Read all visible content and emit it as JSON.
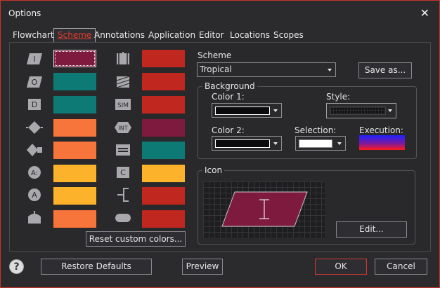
{
  "window": {
    "title": "Options"
  },
  "tabs": [
    "Flowchart",
    "Scheme",
    "Annotations",
    "Application",
    "Editor",
    "Locations",
    "Scopes"
  ],
  "active_tab": "Scheme",
  "symbols_left": [
    {
      "icon": "input-icon",
      "glyph": "I",
      "color": "#7d1a3d"
    },
    {
      "icon": "output-icon",
      "glyph": "O",
      "color": "#0d7a75"
    },
    {
      "icon": "declare-icon",
      "glyph": "D",
      "color": "#0d7a75"
    },
    {
      "icon": "decision-icon",
      "glyph": "",
      "color": "#f7743a"
    },
    {
      "icon": "loop-icon",
      "glyph": "",
      "color": "#f7743a"
    },
    {
      "icon": "assign-icon",
      "glyph": "A:",
      "color": "#fdb22b"
    },
    {
      "icon": "assignment-icon",
      "glyph": "A",
      "color": "#fdb22b"
    },
    {
      "icon": "end-block-icon",
      "glyph": "",
      "color": "#f7743a"
    }
  ],
  "symbols_right": [
    {
      "icon": "call-icon",
      "glyph": "",
      "color": "#c0271f"
    },
    {
      "icon": "parallel-icon",
      "glyph": "",
      "color": "#c0271f"
    },
    {
      "icon": "simulation-icon",
      "glyph": "SIM",
      "color": "#c0271f"
    },
    {
      "icon": "interrupt-icon",
      "glyph": "INT",
      "color": "#7d1a3d"
    },
    {
      "icon": "equals-icon",
      "glyph": "=",
      "color": "#0d7a75"
    },
    {
      "icon": "comment-icon",
      "glyph": "C",
      "color": "#fdb22b"
    },
    {
      "icon": "bracket-icon",
      "glyph": "",
      "color": "#c0271f"
    },
    {
      "icon": "terminal-icon",
      "glyph": "",
      "color": "#c0271f"
    }
  ],
  "reset_custom_colors": "Reset custom colors...",
  "scheme": {
    "label": "Scheme",
    "value": "Tropical",
    "save_as": "Save as..."
  },
  "background": {
    "title": "Background",
    "color1_label": "Color 1:",
    "color1": "#0c0c0e",
    "color2_label": "Color 2:",
    "color2": "#0c0c0e",
    "style_label": "Style:",
    "selection_label": "Selection:",
    "selection_color": "#ffffff",
    "execution_label": "Execution:"
  },
  "icon_group": {
    "title": "Icon",
    "edit": "Edit...",
    "preview_glyph": "I",
    "preview_color": "#7d1a3d"
  },
  "footer": {
    "help": "?",
    "restore_defaults": "Restore Defaults",
    "preview": "Preview",
    "ok": "OK",
    "cancel": "Cancel"
  }
}
